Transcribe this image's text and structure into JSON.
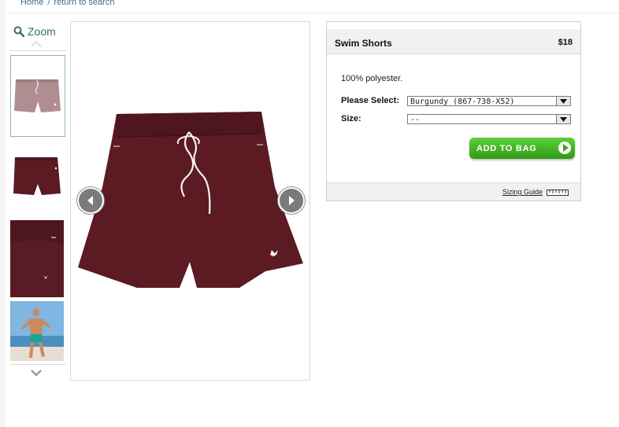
{
  "breadcrumb": {
    "home": "Home",
    "separator": "/",
    "back": "return to search"
  },
  "gallery": {
    "zoom_label": "Zoom",
    "thumbnails": [
      {
        "alt": "burgundy shorts front, small",
        "selected": true
      },
      {
        "alt": "burgundy shorts flat"
      },
      {
        "alt": "burgundy shorts detail"
      },
      {
        "alt": "model wearing shorts"
      }
    ]
  },
  "product": {
    "name": "Swim Shorts",
    "price": "$18",
    "description": "100% polyester.",
    "select_label": "Please Select:",
    "select_value": "Burgundy (867-738-X52)",
    "size_label": "Size:",
    "size_value": "--",
    "add_button": "ADD TO BAG",
    "sizing_guide": "Sizing Guide"
  },
  "colors": {
    "accent_green": "#38a81e",
    "link": "#3f6b88",
    "shorts": "#5c1a22"
  },
  "icons": [
    "search-icon",
    "chevron-up-icon",
    "chevron-down-icon",
    "arrow-left-icon",
    "arrow-right-icon",
    "dropdown-arrow-icon",
    "ruler-icon"
  ]
}
